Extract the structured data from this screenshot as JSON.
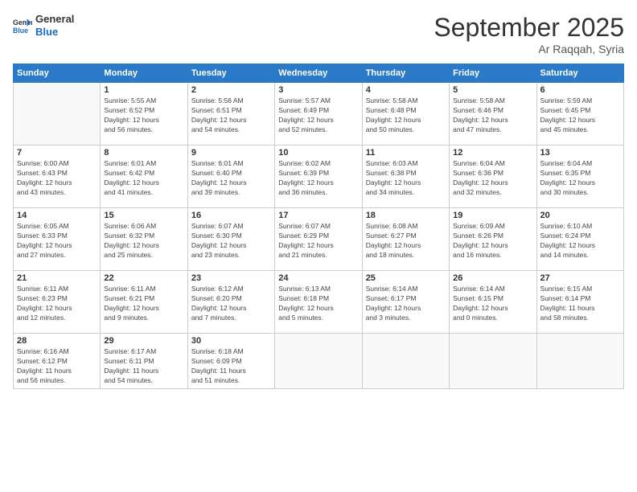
{
  "logo": {
    "line1": "General",
    "line2": "Blue"
  },
  "title": "September 2025",
  "subtitle": "Ar Raqqah, Syria",
  "days_header": [
    "Sunday",
    "Monday",
    "Tuesday",
    "Wednesday",
    "Thursday",
    "Friday",
    "Saturday"
  ],
  "weeks": [
    [
      {
        "day": "",
        "info": ""
      },
      {
        "day": "1",
        "info": "Sunrise: 5:55 AM\nSunset: 6:52 PM\nDaylight: 12 hours\nand 56 minutes."
      },
      {
        "day": "2",
        "info": "Sunrise: 5:56 AM\nSunset: 6:51 PM\nDaylight: 12 hours\nand 54 minutes."
      },
      {
        "day": "3",
        "info": "Sunrise: 5:57 AM\nSunset: 6:49 PM\nDaylight: 12 hours\nand 52 minutes."
      },
      {
        "day": "4",
        "info": "Sunrise: 5:58 AM\nSunset: 6:48 PM\nDaylight: 12 hours\nand 50 minutes."
      },
      {
        "day": "5",
        "info": "Sunrise: 5:58 AM\nSunset: 6:46 PM\nDaylight: 12 hours\nand 47 minutes."
      },
      {
        "day": "6",
        "info": "Sunrise: 5:59 AM\nSunset: 6:45 PM\nDaylight: 12 hours\nand 45 minutes."
      }
    ],
    [
      {
        "day": "7",
        "info": "Sunrise: 6:00 AM\nSunset: 6:43 PM\nDaylight: 12 hours\nand 43 minutes."
      },
      {
        "day": "8",
        "info": "Sunrise: 6:01 AM\nSunset: 6:42 PM\nDaylight: 12 hours\nand 41 minutes."
      },
      {
        "day": "9",
        "info": "Sunrise: 6:01 AM\nSunset: 6:40 PM\nDaylight: 12 hours\nand 39 minutes."
      },
      {
        "day": "10",
        "info": "Sunrise: 6:02 AM\nSunset: 6:39 PM\nDaylight: 12 hours\nand 36 minutes."
      },
      {
        "day": "11",
        "info": "Sunrise: 6:03 AM\nSunset: 6:38 PM\nDaylight: 12 hours\nand 34 minutes."
      },
      {
        "day": "12",
        "info": "Sunrise: 6:04 AM\nSunset: 6:36 PM\nDaylight: 12 hours\nand 32 minutes."
      },
      {
        "day": "13",
        "info": "Sunrise: 6:04 AM\nSunset: 6:35 PM\nDaylight: 12 hours\nand 30 minutes."
      }
    ],
    [
      {
        "day": "14",
        "info": "Sunrise: 6:05 AM\nSunset: 6:33 PM\nDaylight: 12 hours\nand 27 minutes."
      },
      {
        "day": "15",
        "info": "Sunrise: 6:06 AM\nSunset: 6:32 PM\nDaylight: 12 hours\nand 25 minutes."
      },
      {
        "day": "16",
        "info": "Sunrise: 6:07 AM\nSunset: 6:30 PM\nDaylight: 12 hours\nand 23 minutes."
      },
      {
        "day": "17",
        "info": "Sunrise: 6:07 AM\nSunset: 6:29 PM\nDaylight: 12 hours\nand 21 minutes."
      },
      {
        "day": "18",
        "info": "Sunrise: 6:08 AM\nSunset: 6:27 PM\nDaylight: 12 hours\nand 18 minutes."
      },
      {
        "day": "19",
        "info": "Sunrise: 6:09 AM\nSunset: 6:26 PM\nDaylight: 12 hours\nand 16 minutes."
      },
      {
        "day": "20",
        "info": "Sunrise: 6:10 AM\nSunset: 6:24 PM\nDaylight: 12 hours\nand 14 minutes."
      }
    ],
    [
      {
        "day": "21",
        "info": "Sunrise: 6:11 AM\nSunset: 6:23 PM\nDaylight: 12 hours\nand 12 minutes."
      },
      {
        "day": "22",
        "info": "Sunrise: 6:11 AM\nSunset: 6:21 PM\nDaylight: 12 hours\nand 9 minutes."
      },
      {
        "day": "23",
        "info": "Sunrise: 6:12 AM\nSunset: 6:20 PM\nDaylight: 12 hours\nand 7 minutes."
      },
      {
        "day": "24",
        "info": "Sunrise: 6:13 AM\nSunset: 6:18 PM\nDaylight: 12 hours\nand 5 minutes."
      },
      {
        "day": "25",
        "info": "Sunrise: 6:14 AM\nSunset: 6:17 PM\nDaylight: 12 hours\nand 3 minutes."
      },
      {
        "day": "26",
        "info": "Sunrise: 6:14 AM\nSunset: 6:15 PM\nDaylight: 12 hours\nand 0 minutes."
      },
      {
        "day": "27",
        "info": "Sunrise: 6:15 AM\nSunset: 6:14 PM\nDaylight: 11 hours\nand 58 minutes."
      }
    ],
    [
      {
        "day": "28",
        "info": "Sunrise: 6:16 AM\nSunset: 6:12 PM\nDaylight: 11 hours\nand 56 minutes."
      },
      {
        "day": "29",
        "info": "Sunrise: 6:17 AM\nSunset: 6:11 PM\nDaylight: 11 hours\nand 54 minutes."
      },
      {
        "day": "30",
        "info": "Sunrise: 6:18 AM\nSunset: 6:09 PM\nDaylight: 11 hours\nand 51 minutes."
      },
      {
        "day": "",
        "info": ""
      },
      {
        "day": "",
        "info": ""
      },
      {
        "day": "",
        "info": ""
      },
      {
        "day": "",
        "info": ""
      }
    ]
  ]
}
